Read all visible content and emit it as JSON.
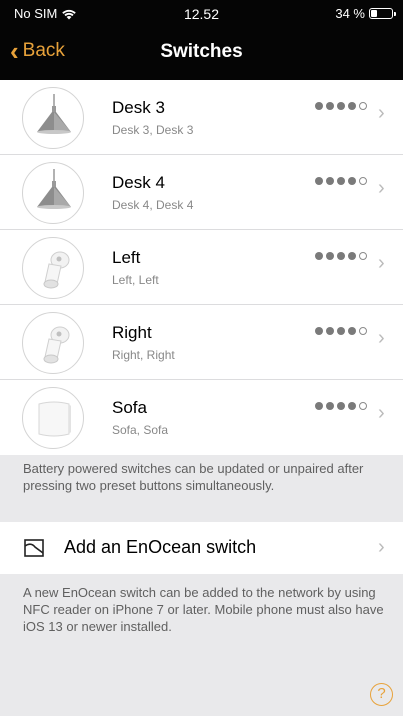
{
  "status": {
    "carrier": "No SIM",
    "wifi_icon": "wifi-icon",
    "time": "12.52",
    "battery_text": "34 %",
    "battery_level": 0.34
  },
  "nav": {
    "back_label": "Back",
    "title": "Switches"
  },
  "switches": [
    {
      "name": "Desk 3",
      "detail": "Desk 3, Desk 3",
      "icon": "pendant-lamp-icon",
      "signal": 4,
      "signal_max": 5
    },
    {
      "name": "Desk 4",
      "detail": "Desk 4, Desk 4",
      "icon": "pendant-lamp-icon",
      "signal": 4,
      "signal_max": 5
    },
    {
      "name": "Left",
      "detail": "Left, Left",
      "icon": "spotlight-icon",
      "signal": 4,
      "signal_max": 5
    },
    {
      "name": "Right",
      "detail": "Right, Right",
      "icon": "spotlight-icon",
      "signal": 4,
      "signal_max": 5
    },
    {
      "name": "Sofa",
      "detail": "Sofa, Sofa",
      "icon": "wall-lamp-icon",
      "signal": 4,
      "signal_max": 5
    }
  ],
  "battery_note": "Battery powered switches can be updated or unpaired after pressing two preset buttons simultaneously.",
  "add_switch": {
    "label": "Add an EnOcean switch",
    "icon": "enocean-switch-icon"
  },
  "enocean_note": "A new EnOcean switch can be added to the network by using NFC reader on iPhone 7 or later. Mobile phone must also have iOS 13 or newer installed.",
  "help": {
    "label": "?",
    "icon": "help-icon"
  },
  "colors": {
    "accent": "#e8a23a",
    "header_bg": "#050505",
    "page_bg": "#e9e9eb",
    "note_text": "#606060"
  }
}
